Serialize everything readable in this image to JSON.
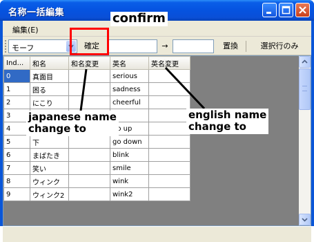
{
  "window": {
    "title": "名称一括編集"
  },
  "menu": {
    "edit": "編集(E)"
  },
  "toolbar": {
    "combo_value": "モーフ",
    "confirm_label": "確定",
    "arrow_label": "→",
    "replace_label": "置換",
    "selected_rows_label": "選択行のみ"
  },
  "grid": {
    "headers": [
      "Ind...",
      "和名",
      "和名変更",
      "英名",
      "英名変更"
    ],
    "rows": [
      [
        "0",
        "真面目",
        "",
        "serious",
        ""
      ],
      [
        "1",
        "困る",
        "",
        "sadness",
        ""
      ],
      [
        "2",
        "にこり",
        "",
        "cheerful",
        ""
      ],
      [
        "3",
        "",
        "",
        "",
        ""
      ],
      [
        "4",
        "",
        "",
        "go up",
        ""
      ],
      [
        "5",
        "下",
        "",
        "go down",
        ""
      ],
      [
        "6",
        "まばたき",
        "",
        "blink",
        ""
      ],
      [
        "7",
        "笑い",
        "",
        "smile",
        ""
      ],
      [
        "8",
        "ウィンク",
        "",
        "wink",
        ""
      ],
      [
        "9",
        "ウィンク2",
        "",
        "wink2",
        ""
      ]
    ]
  },
  "annotations": {
    "confirm": "confirm",
    "japanese_line1": "japanese name",
    "japanese_line2": "change to",
    "english_line1": "english name",
    "english_line2": "change to"
  },
  "colors": {
    "title_blue": "#0553e0",
    "highlight_red": "#ff0000",
    "selected_cell": "#316ac5"
  }
}
